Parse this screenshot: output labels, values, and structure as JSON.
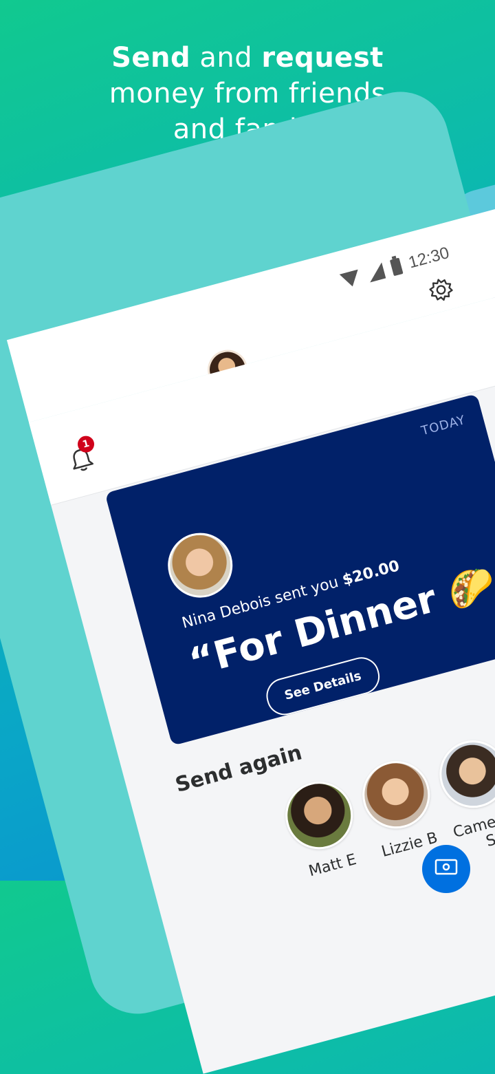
{
  "headline": {
    "line1_bold_a": "Send",
    "line1_mid": " and ",
    "line1_bold_b": "request",
    "line2": "money from friends",
    "line3": "and family"
  },
  "status_bar": {
    "time": "12:30"
  },
  "notifications": {
    "count": "1"
  },
  "activity_card": {
    "date_label": "TODAY",
    "sender_text": "Nina Debois sent you ",
    "amount": "$20.00",
    "memo": "“For Dinner 🌮🍕”",
    "button_label": "See Details"
  },
  "send_again": {
    "title": "Send again",
    "contacts": [
      {
        "name": "Matt E"
      },
      {
        "name": "Lizzie B"
      },
      {
        "name": "Cameron S"
      },
      {
        "name": ""
      }
    ]
  },
  "colors": {
    "card_bg": "#012169",
    "badge": "#d0021b",
    "fab": "#0070e0"
  },
  "icons": [
    "wifi-icon",
    "signal-icon",
    "battery-icon",
    "gear-icon",
    "bell-icon",
    "send-money-icon"
  ]
}
